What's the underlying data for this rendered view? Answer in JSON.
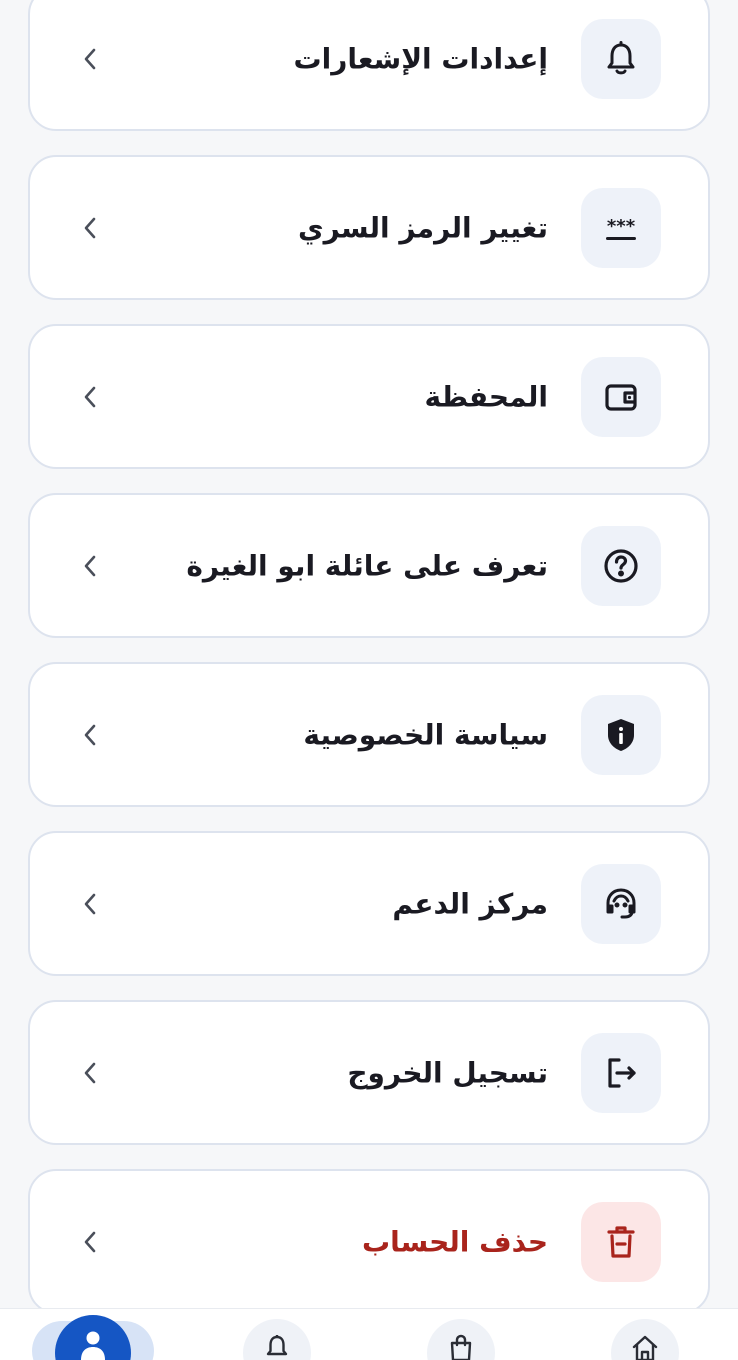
{
  "menu": [
    {
      "label": "إعدادات الإشعارات",
      "icon": "bell-icon"
    },
    {
      "label": "تغيير الرمز السري",
      "icon": "password-icon"
    },
    {
      "label": "المحفظة",
      "icon": "wallet-icon"
    },
    {
      "label": "تعرف على عائلة ابو الغيرة",
      "icon": "question-icon"
    },
    {
      "label": "سياسة الخصوصية",
      "icon": "shield-icon"
    },
    {
      "label": "مركز الدعم",
      "icon": "headset-icon"
    },
    {
      "label": "تسجيل الخروج",
      "icon": "logout-icon"
    },
    {
      "label": "حذف الحساب",
      "icon": "trash-icon"
    }
  ],
  "bottom_nav": [
    {
      "icon": "profile-icon",
      "active": true
    },
    {
      "icon": "bell-icon",
      "active": false
    },
    {
      "icon": "shopping-bag-icon",
      "active": false
    },
    {
      "icon": "home-icon",
      "active": false
    }
  ],
  "colors": {
    "accent": "#1556c4",
    "danger": "#a9241c",
    "danger_bg": "#fce6e6",
    "icon_bg": "#eef2f9",
    "text": "#1a1a22"
  }
}
